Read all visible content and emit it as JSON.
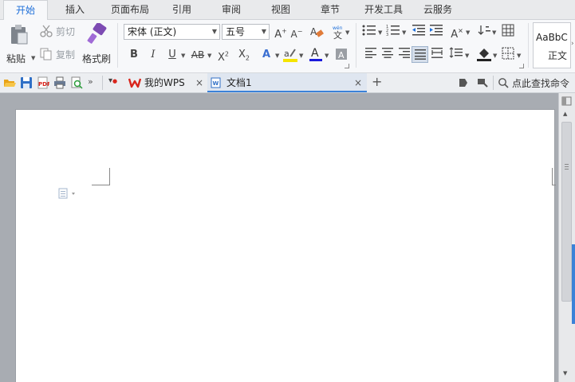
{
  "menu": {
    "tabs": [
      "开始",
      "插入",
      "页面布局",
      "引用",
      "审阅",
      "视图",
      "章节",
      "开发工具",
      "云服务"
    ],
    "active": "开始"
  },
  "clipboard": {
    "paste": "粘贴",
    "cut": "剪切",
    "copy": "复制",
    "format_painter": "格式刷"
  },
  "font": {
    "family": "宋体 (正文)",
    "size": "五号"
  },
  "styles": {
    "preview": "AaBbC",
    "name": "正文"
  },
  "quickbar": {
    "tabs": [
      "我的WPS",
      "文档1"
    ],
    "find_label": "点此查找命令"
  },
  "colors": {
    "accent": "#1e6fd9",
    "wps_red": "#d9251c",
    "highlight": "#f5e400",
    "font_color": "#1a1adb"
  }
}
